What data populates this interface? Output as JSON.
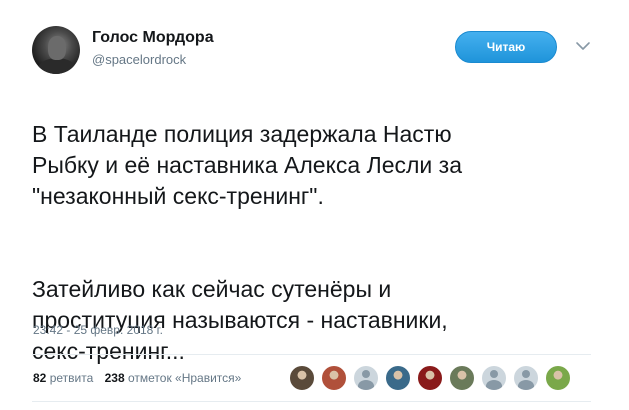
{
  "author": {
    "display_name": "Голос Мордора",
    "screen_name": "@spacelordrock"
  },
  "follow_button": {
    "label": "Читаю"
  },
  "tweet": {
    "paragraphs": [
      "В Таиланде полиция задержала Настю\nРыбку и её наставника Алекса Лесли за\n\"незаконный секс-тренинг\".",
      "Затейливо как сейчас сутенёры и\nпроституция называются - наставники,\nсекс-тренинг..."
    ],
    "timestamp": "23:42 - 25 февр. 2018 г."
  },
  "stats": {
    "retweets_count": "82",
    "retweets_label": "ретвита",
    "likes_count": "238",
    "likes_label": "отметок «Нравится»"
  },
  "likers": [
    {
      "icon": "user-avatar",
      "color": "#5a4a3a"
    },
    {
      "icon": "user-avatar",
      "color": "#b0503a"
    },
    {
      "icon": "default-egg-avatar",
      "color": "#ccd6dd"
    },
    {
      "icon": "user-avatar",
      "color": "#3a6a8a"
    },
    {
      "icon": "user-avatar",
      "color": "#8a1a1a"
    },
    {
      "icon": "user-avatar",
      "color": "#6a7a5a"
    },
    {
      "icon": "default-egg-avatar",
      "color": "#ccd6dd"
    },
    {
      "icon": "default-egg-avatar",
      "color": "#ccd6dd"
    },
    {
      "icon": "user-avatar",
      "color": "#7aa84a"
    }
  ],
  "colors": {
    "accent": "#1da1f2",
    "text": "#14171a",
    "secondary": "#657786",
    "divider": "#e6ecf0"
  }
}
